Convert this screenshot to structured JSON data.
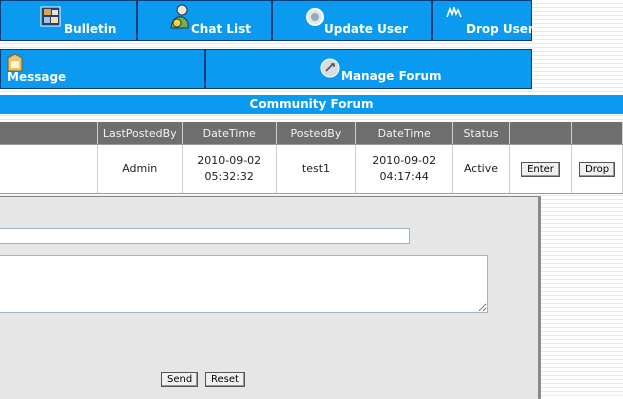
{
  "nav_row1": [
    {
      "label": "Bulletin",
      "icon": "bulletin-icon"
    },
    {
      "label": "Chat List",
      "icon": "chat-list-icon"
    },
    {
      "label": "Update User",
      "icon": "update-user-icon"
    },
    {
      "label": "Drop User",
      "icon": "drop-user-icon"
    }
  ],
  "nav_row2": [
    {
      "label": "Message",
      "icon": "message-icon"
    },
    {
      "label": "Manage Forum",
      "icon": "manage-forum-icon"
    }
  ],
  "forum_title": "Community Forum",
  "table": {
    "headers": [
      "LastPostedBy",
      "DateTime",
      "PostedBy",
      "DateTime",
      "Status",
      "",
      ""
    ],
    "rows": [
      {
        "last_posted_by": "Admin",
        "last_datetime_date": "2010-09-02",
        "last_datetime_time": "05:32:32",
        "posted_by": "test1",
        "datetime_date": "2010-09-02",
        "datetime_time": "04:17:44",
        "status": "Active",
        "enter_label": "Enter",
        "drop_label": "Drop"
      }
    ]
  },
  "compose": {
    "subject_value": "",
    "message_value": "",
    "send_label": "Send",
    "reset_label": "Reset"
  },
  "colors": {
    "nav_blue": "#0a9af0",
    "header_gray": "#6e6e6e",
    "panel_gray": "#e6e6e6"
  }
}
